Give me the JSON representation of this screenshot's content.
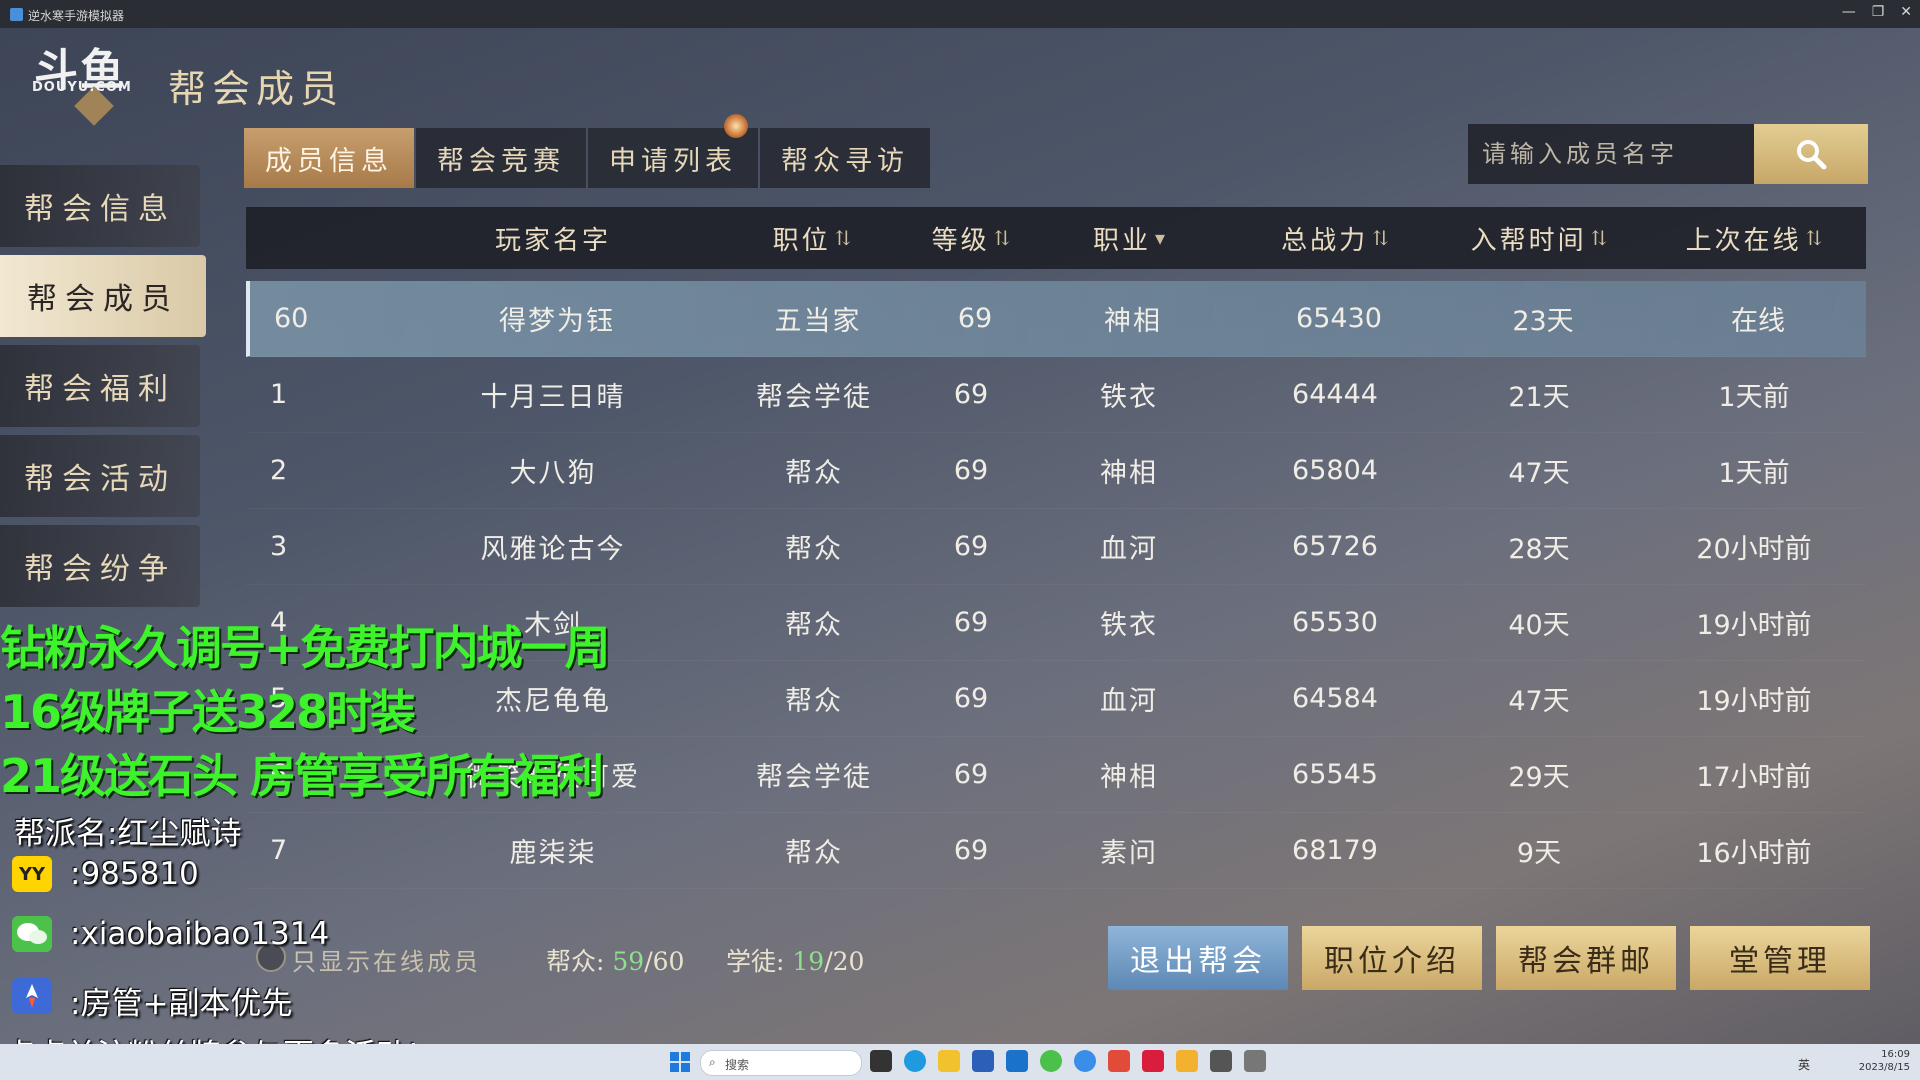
{
  "window": {
    "title": "逆水寒手游模拟器",
    "buttons": [
      "—",
      "❐",
      "✕"
    ]
  },
  "logo": {
    "mark": "斗鱼",
    "sub": "DOUYU.COM"
  },
  "page_title": "帮会成员",
  "sidebar": {
    "items": [
      {
        "label": "帮会信息",
        "active": false
      },
      {
        "label": "帮会成员",
        "active": true
      },
      {
        "label": "帮会福利",
        "active": false
      },
      {
        "label": "帮会活动",
        "active": false
      },
      {
        "label": "帮会纷争",
        "active": false
      }
    ]
  },
  "tabs": [
    {
      "label": "成员信息",
      "active": true
    },
    {
      "label": "帮会竞赛",
      "active": false
    },
    {
      "label": "申请列表",
      "active": false
    },
    {
      "label": "帮众寻访",
      "active": false
    }
  ],
  "search": {
    "placeholder": "请输入成员名字",
    "icon": "search-icon"
  },
  "table": {
    "headers": {
      "name": "玩家名字",
      "position": "职位",
      "level": "等级",
      "class": "职业",
      "power": "总战力",
      "join": "入帮时间",
      "last": "上次在线"
    },
    "rows": [
      {
        "rank": "60",
        "name": "得梦为钰",
        "position": "五当家",
        "level": "69",
        "class": "神相",
        "power": "65430",
        "join": "23天",
        "last": "在线",
        "self": true
      },
      {
        "rank": "1",
        "name": "十月三日晴",
        "position": "帮会学徒",
        "level": "69",
        "class": "铁衣",
        "power": "64444",
        "join": "21天",
        "last": "1天前"
      },
      {
        "rank": "2",
        "name": "大八狗",
        "position": "帮众",
        "level": "69",
        "class": "神相",
        "power": "65804",
        "join": "47天",
        "last": "1天前"
      },
      {
        "rank": "3",
        "name": "风雅论古今",
        "position": "帮众",
        "level": "69",
        "class": "血河",
        "power": "65726",
        "join": "28天",
        "last": "20小时前"
      },
      {
        "rank": "4",
        "name": "木剑",
        "position": "帮众",
        "level": "69",
        "class": "铁衣",
        "power": "65530",
        "join": "40天",
        "last": "19小时前"
      },
      {
        "rank": "5",
        "name": "杰尼龟龟",
        "position": "帮众",
        "level": "69",
        "class": "血河",
        "power": "64584",
        "join": "47天",
        "last": "19小时前"
      },
      {
        "rank": "6",
        "name": "微笑时很可爱",
        "position": "帮会学徒",
        "level": "69",
        "class": "神相",
        "power": "65545",
        "join": "29天",
        "last": "17小时前"
      },
      {
        "rank": "7",
        "name": "鹿柒柒",
        "position": "帮众",
        "level": "69",
        "class": "素问",
        "power": "68179",
        "join": "9天",
        "last": "16小时前"
      }
    ]
  },
  "footer": {
    "online_toggle": "只显示在线成员",
    "members_label": "帮众:",
    "members_current": "59",
    "members_max": "/60",
    "apprentice_label": "学徒:",
    "apprentice_current": "19",
    "apprentice_max": "/20",
    "buttons": [
      "退出帮会",
      "职位介绍",
      "帮会群邮",
      "堂管理"
    ]
  },
  "overlay": {
    "promo_lines": [
      "钻粉永久调号+免费打内城一周",
      "16级牌子送328时装",
      "21级送石头 房管享受所有福利"
    ],
    "guild_line": "帮派名:红尘赋诗",
    "yy_badge": "YY",
    "yy_line": ":985810",
    "wechat_line": ":xiaobaibao1314",
    "perk_line": ":房管+副本优先",
    "follow_line": "点点关注粉丝牌参与更多活动!"
  },
  "taskbar": {
    "search_label": "搜索",
    "time": "16:09",
    "date": "2023/8/15",
    "lang": "英"
  },
  "colors": {
    "accent_gold": "#c7a768",
    "highlight_green": "#8ee08f",
    "promo_green": "#3ef22c",
    "button_blue": "#5d88b5"
  }
}
